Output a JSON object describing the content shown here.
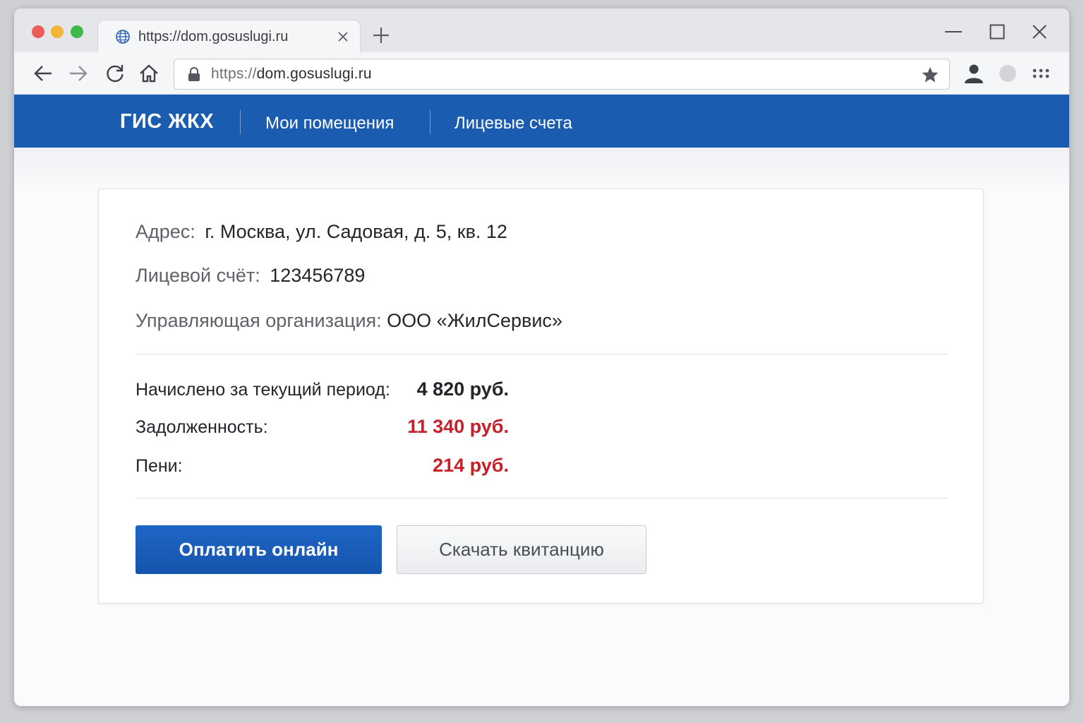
{
  "browser": {
    "tab_title": "https://dom.gosuslugi.ru",
    "url_scheme": "https://",
    "url_host": "dom.gosuslugi.ru",
    "icons": [
      "globe-icon",
      "close-icon",
      "plus-icon",
      "minimize-icon",
      "maximize-icon",
      "window-close-icon",
      "back-icon",
      "forward-icon",
      "reload-icon",
      "home-icon",
      "lock-icon",
      "star-icon",
      "profile-icon",
      "extension-icon",
      "menu-icon"
    ]
  },
  "site": {
    "logo": "ГИС ЖКХ",
    "nav": [
      {
        "label": "Мои помещения"
      },
      {
        "label": "Лицевые счета"
      }
    ],
    "accent_color": "#1a5cb0"
  },
  "account": {
    "address_label": "Адрес:",
    "address_value": "г. Москва,  ул. Садовая, д. 5, кв. 12",
    "account_label": "Лицевой счёт:",
    "account_value": "123456789",
    "org_label": "Управляющая организация:",
    "org_value": "ООО «ЖилСервис»"
  },
  "charges": {
    "current_label": "Начислено за текущий период:",
    "current_value": "4 820 руб.",
    "debt_label": "Задолженность:",
    "debt_value": "11 340 руб.",
    "penalty_label": "Пени:",
    "penalty_value": "214 руб.",
    "normal_color": "#22262b",
    "alert_color": "#c6202a"
  },
  "actions": {
    "pay_label": "Оплатить онлайн",
    "download_label": "Скачать квитанцию"
  }
}
